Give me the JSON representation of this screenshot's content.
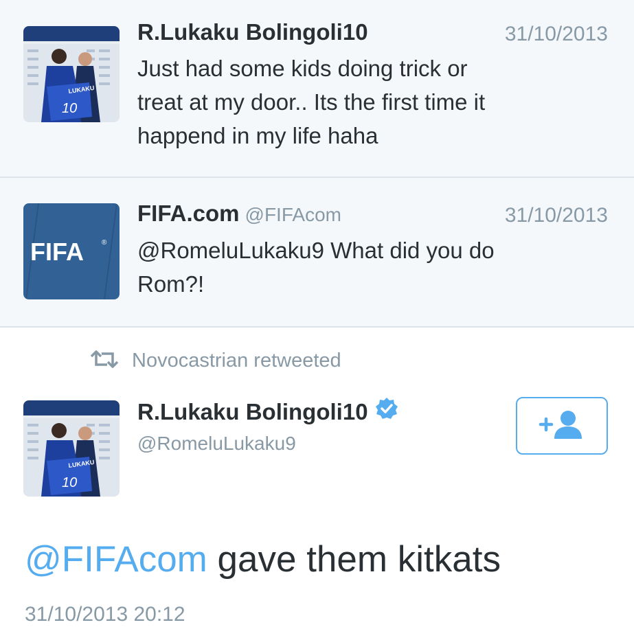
{
  "tweets": [
    {
      "name": "R.Lukaku Bolingoli10",
      "date": "31/10/2013",
      "lines": [
        "Just had some kids doing trick or",
        "treat at my door.. Its the first time it",
        "happend in my life haha"
      ],
      "avatar_shirt_name": "LUKAKU",
      "avatar_shirt_number": "10"
    },
    {
      "name": "FIFA.com",
      "handle": "@FIFAcom",
      "date": "31/10/2013",
      "lines": [
        "@RomeluLukaku9 What did you do",
        "Rom?!"
      ],
      "logo_text": "FIFA",
      "logo_mark": "®"
    }
  ],
  "retweet": {
    "label": "Novocastrian retweeted",
    "icon": "retweet-icon"
  },
  "detail": {
    "name": "R.Lukaku Bolingoli10",
    "handle": "@RomeluLukaku9",
    "verified_icon": "verified-badge-icon",
    "follow_icon": "add-user-icon",
    "avatar_shirt_name": "LUKAKU",
    "avatar_shirt_number": "10",
    "mention": "@FIFAcom",
    "text_rest": " gave them kitkats",
    "timestamp": "31/10/2013 20:12"
  },
  "colors": {
    "accent": "#55acee",
    "fifa_blue": "#326295",
    "secondary_text": "#8899a6",
    "primary_text": "#292f33",
    "tweet_bg": "#f5f8fa"
  }
}
